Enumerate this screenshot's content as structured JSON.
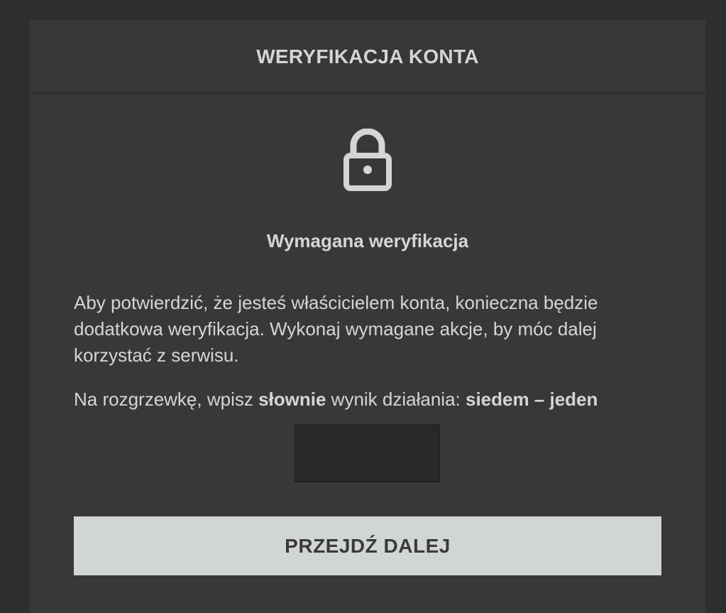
{
  "header": {
    "title": "WERYFIKACJA KONTA"
  },
  "lock": {
    "icon": "lock-icon",
    "color": "#d4d6d6"
  },
  "content": {
    "subtitle": "Wymagana weryfikacja",
    "description": "Aby potwierdzić, że jesteś właścicielem konta, konieczna będzie dodatkowa weryfikacja. Wykonaj wymagane akcje, by móc dalej korzystać z serwisu.",
    "task": {
      "prefix": "Na rozgrzewkę, wpisz ",
      "emphasis_word": "słownie",
      "middle": " wynik działania: ",
      "expression": "siedem – jeden"
    }
  },
  "form": {
    "answer_value": "",
    "answer_placeholder": ""
  },
  "actions": {
    "submit_label": "PRZEJDŹ DALEJ"
  },
  "colors": {
    "page_background": "#2e2e2e",
    "panel_background": "#383838",
    "text": "#d4d6d6",
    "input_background": "#282828",
    "button_background": "#d1d5d5",
    "button_text": "#3a3a3a"
  }
}
